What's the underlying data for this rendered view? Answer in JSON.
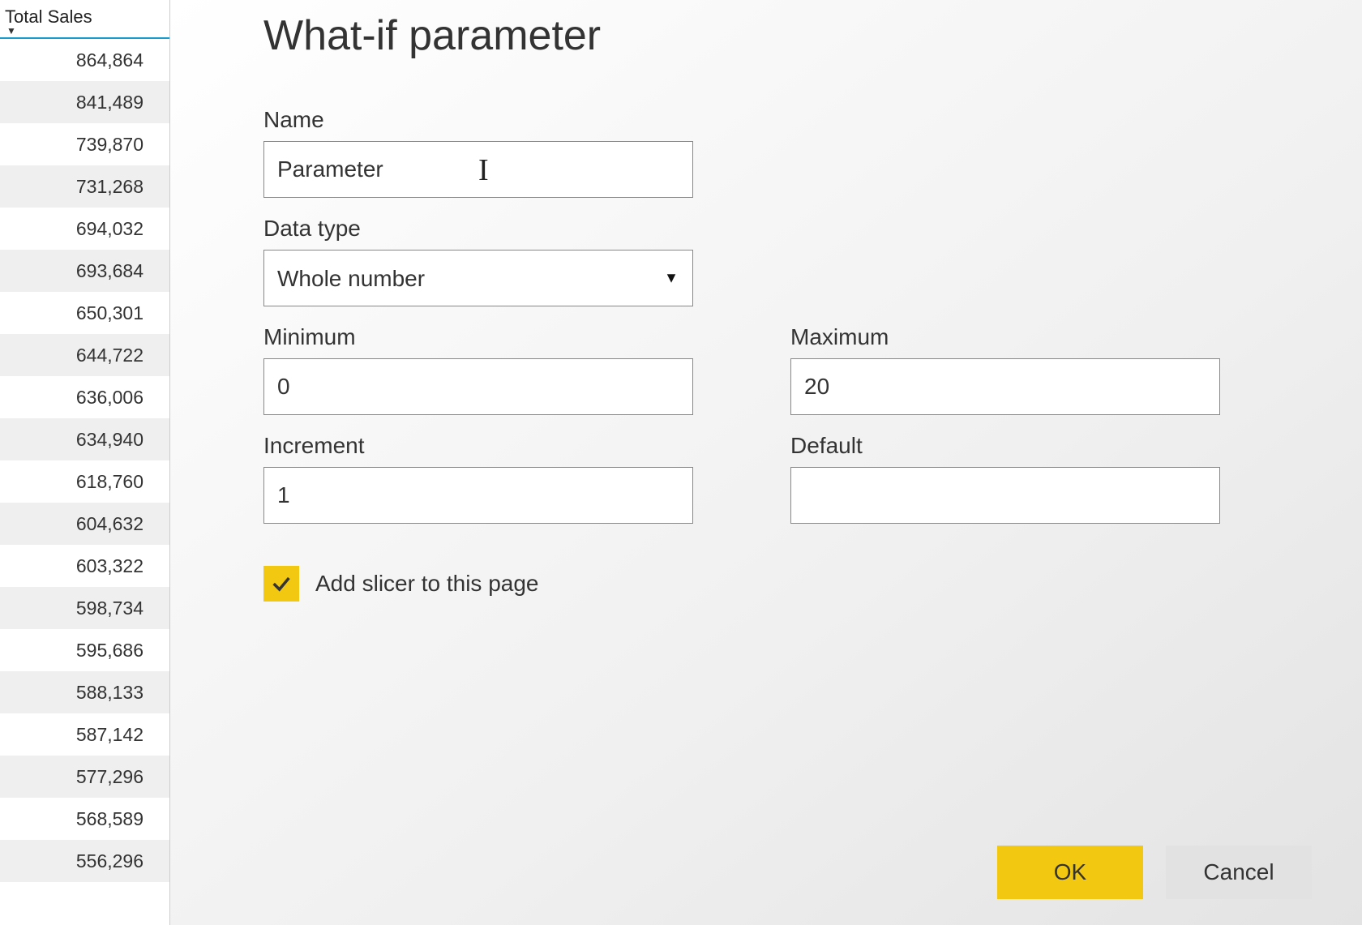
{
  "sidebar": {
    "header": "Total Sales",
    "rows": [
      "864,864",
      "841,489",
      "739,870",
      "731,268",
      "694,032",
      "693,684",
      "650,301",
      "644,722",
      "636,006",
      "634,940",
      "618,760",
      "604,632",
      "603,322",
      "598,734",
      "595,686",
      "588,133",
      "587,142",
      "577,296",
      "568,589",
      "556,296"
    ]
  },
  "dialog": {
    "title": "What-if parameter",
    "labels": {
      "name": "Name",
      "data_type": "Data type",
      "minimum": "Minimum",
      "maximum": "Maximum",
      "increment": "Increment",
      "default": "Default"
    },
    "values": {
      "name": "Parameter",
      "data_type": "Whole number",
      "minimum": "0",
      "maximum": "20",
      "increment": "1",
      "default": ""
    },
    "checkbox": {
      "label": "Add slicer to this page",
      "checked": true
    },
    "buttons": {
      "ok": "OK",
      "cancel": "Cancel"
    }
  }
}
